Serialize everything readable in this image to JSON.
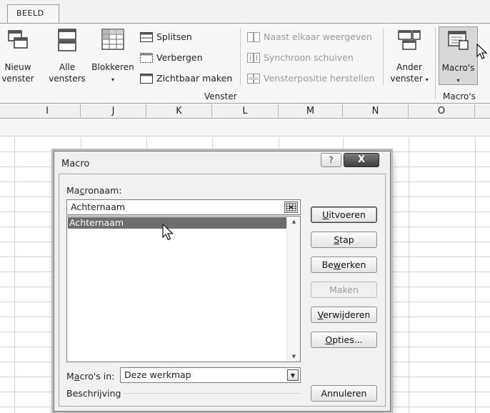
{
  "ribbon": {
    "tab_label": "BEELD",
    "buttons": {
      "new_window": {
        "line1": "Nieuw",
        "line2": "venster"
      },
      "arrange_all": {
        "line1": "Alle",
        "line2": "vensters"
      },
      "freeze": {
        "line1": "Blokkeren",
        "caret": "▾"
      },
      "switch_windows": {
        "line1": "Ander",
        "line2": "venster",
        "caret": "▾"
      },
      "macros": {
        "line1": "Macro's",
        "caret": "▾"
      }
    },
    "small_buttons": {
      "split": "Splitsen",
      "hide": "Verbergen",
      "unhide": "Zichtbaar maken",
      "side_by_side": "Naast elkaar weergeven",
      "sync_scroll": "Synchroon schuiven",
      "reset_position": "Vensterpositie herstellen"
    },
    "group_labels": {
      "window": "Venster",
      "macros": "Macro's"
    }
  },
  "columns": [
    "I",
    "J",
    "K",
    "L",
    "M",
    "N",
    "O"
  ],
  "dialog": {
    "title": "Macro",
    "help_glyph": "?",
    "close_glyph": "X",
    "macro_name_label": {
      "before": "Ma",
      "accel": "c",
      "after": "ronaam:"
    },
    "macro_name_value": "Achternaam",
    "macro_list": [
      "Achternaam"
    ],
    "macros_in_label": {
      "before": "M",
      "accel": "a",
      "after": "cro's in:"
    },
    "macros_in_value": "Deze werkmap",
    "description_label": "Beschrijving",
    "buttons": {
      "run": {
        "accel": "U",
        "rest": "itvoeren"
      },
      "step": {
        "accel": "S",
        "rest": "tap"
      },
      "edit": {
        "before": "Be",
        "accel": "w",
        "after": "erken"
      },
      "create": "Maken",
      "delete": {
        "accel": "V",
        "rest": "erwijderen"
      },
      "options": {
        "accel": "O",
        "rest": "pties..."
      },
      "cancel": "Annuleren"
    }
  },
  "colors": {
    "selection": "#6d6d6d",
    "ribbon_bg": "#f7f7f7",
    "dialog_bg": "#f0f0f0"
  }
}
